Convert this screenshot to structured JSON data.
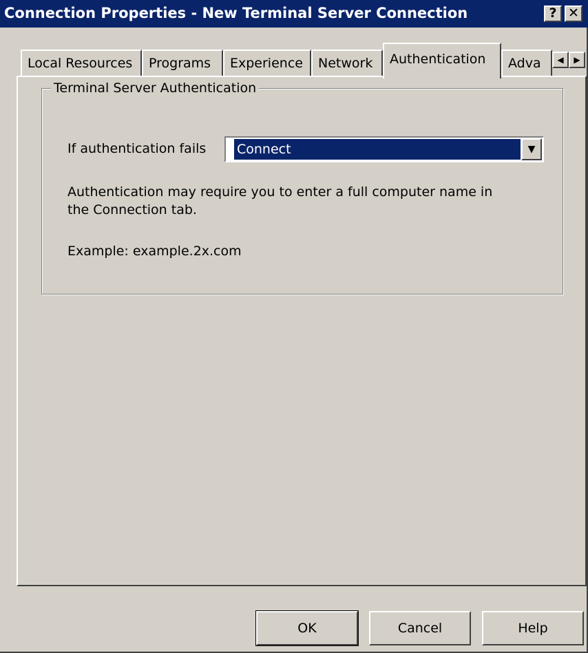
{
  "window": {
    "title": "Connection Properties - New Terminal Server Connection",
    "help_label": "?",
    "close_label": "✕"
  },
  "tabs": [
    {
      "label": "Local Resources",
      "active": false
    },
    {
      "label": "Programs",
      "active": false
    },
    {
      "label": "Experience",
      "active": false
    },
    {
      "label": "Network",
      "active": false
    },
    {
      "label": "Authentication",
      "active": true
    },
    {
      "label": "Adva",
      "active": false
    }
  ],
  "tab_scroll": {
    "left": "◀",
    "right": "▶"
  },
  "auth_group": {
    "title": "Terminal Server Authentication",
    "fail_label": "If authentication fails",
    "fail_value": "Connect",
    "description_line1": "Authentication may require you to enter a full computer name in",
    "description_line2": "the Connection tab.",
    "example": "Example: example.2x.com"
  },
  "buttons": {
    "ok": "OK",
    "cancel": "Cancel",
    "help": "Help"
  },
  "colors": {
    "titlebar": "#0a246a",
    "face": "#d4d0c8",
    "selection": "#0a246a"
  }
}
